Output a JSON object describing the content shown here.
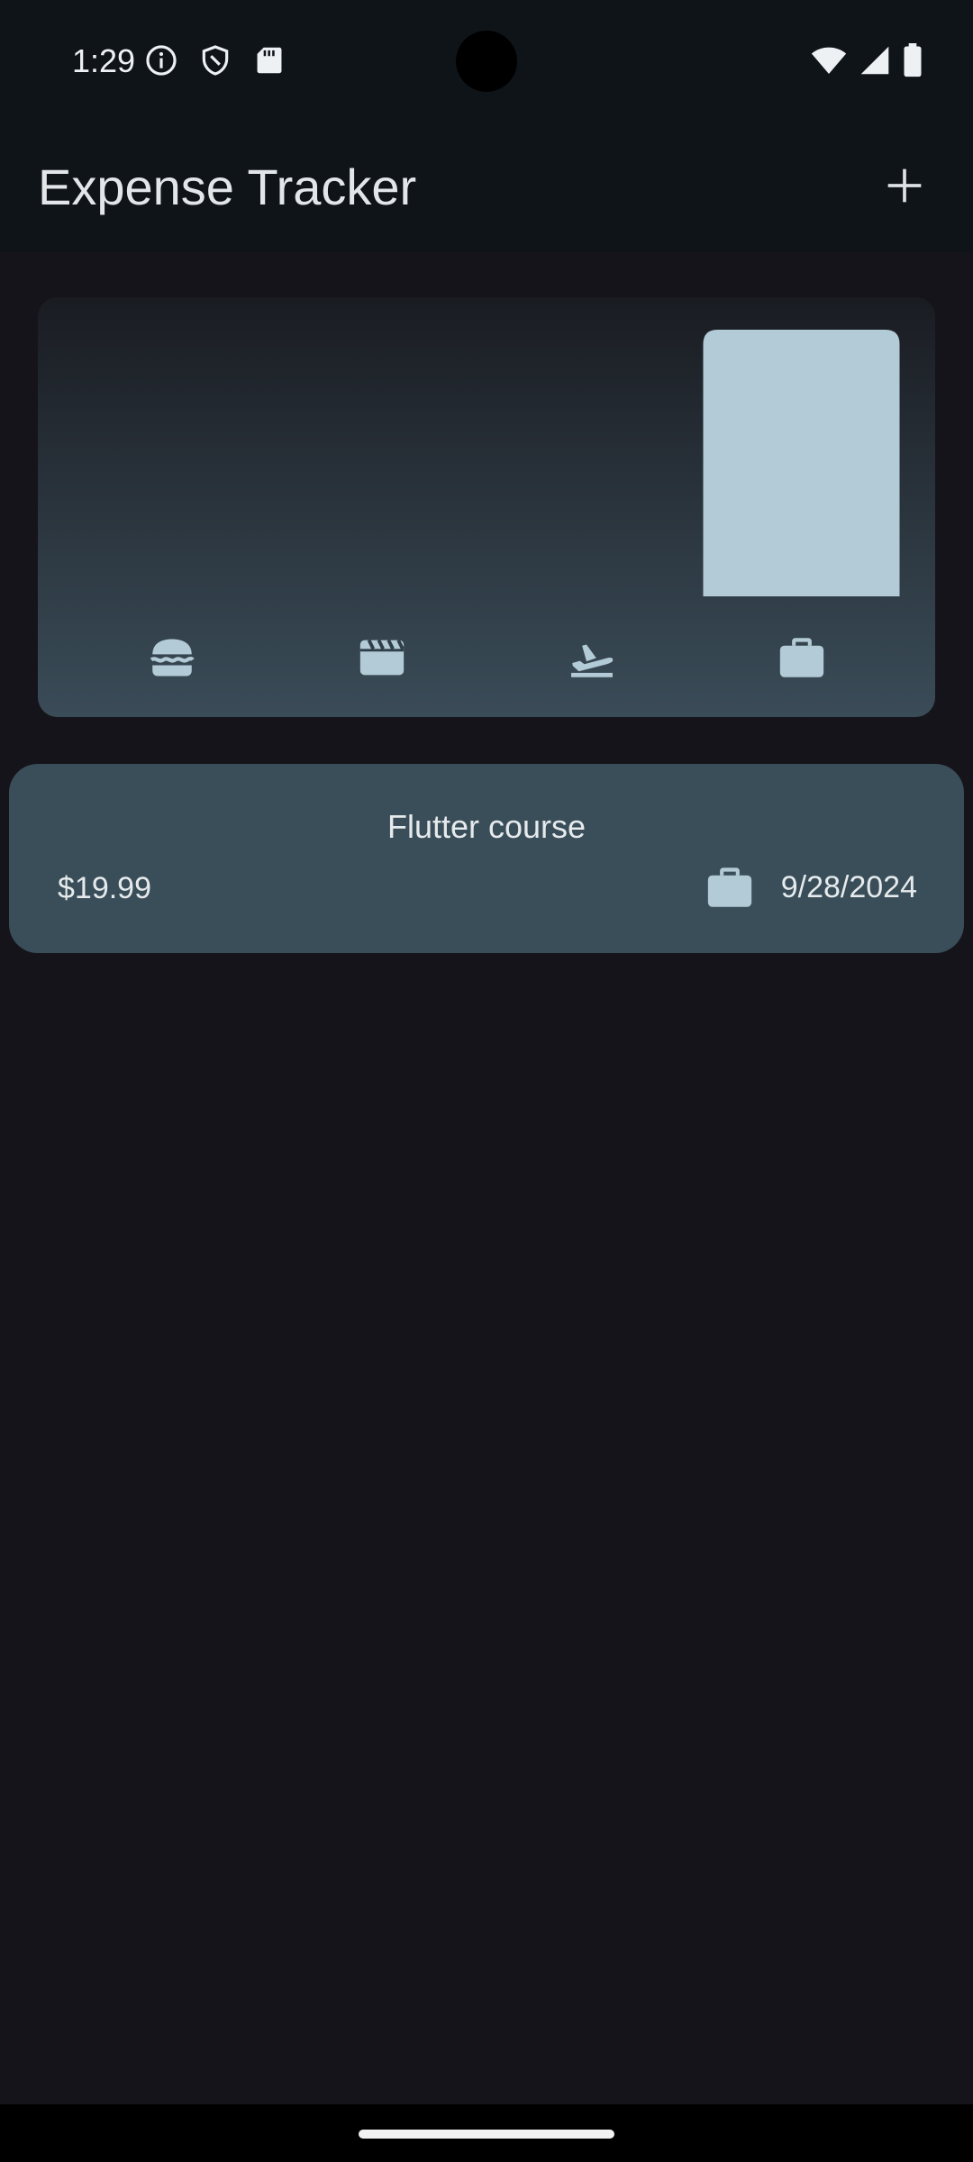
{
  "status_bar": {
    "time": "1:29",
    "left_icons": [
      "info-icon",
      "shield-icon",
      "sd-card-icon"
    ],
    "right_icons": [
      "wifi-icon",
      "signal-icon",
      "battery-icon"
    ]
  },
  "app_bar": {
    "title": "Expense Tracker",
    "add_icon": "plus-icon"
  },
  "chart_data": {
    "type": "bar",
    "categories": [
      "food",
      "leisure",
      "travel",
      "work"
    ],
    "category_icons": [
      "burger-icon",
      "clapperboard-icon",
      "flight-takeoff-icon",
      "briefcase-icon"
    ],
    "values": [
      0,
      0,
      0,
      1
    ],
    "ylim": [
      0,
      1
    ],
    "bar_color": "#b3cbd6"
  },
  "expenses": [
    {
      "title": "Flutter course",
      "amount": "$19.99",
      "category_icon": "briefcase-icon",
      "date": "9/28/2024"
    }
  ],
  "colors": {
    "background": "#16141b",
    "app_bar": "#0f1418",
    "card": "#394e59",
    "accent": "#b3cbd6"
  }
}
